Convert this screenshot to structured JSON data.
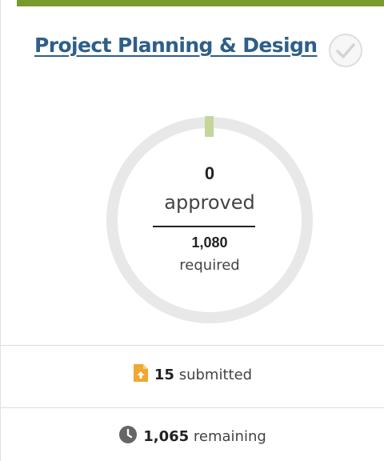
{
  "card": {
    "accent_color": "#7a9a2b",
    "title": "Project Planning & Design",
    "title_color": "#2d5f8a",
    "check_icon": "check-circle-icon"
  },
  "progress": {
    "approved_count": "0",
    "approved_label": "approved",
    "required_count": "1,080",
    "required_label": "required",
    "approved_fraction": 0,
    "ring_track_color": "#e8e8e8",
    "ring_marker_color": "#c5d69a"
  },
  "stats": {
    "submitted": {
      "icon": "file-upload-icon",
      "icon_color": "#f0a830",
      "count": "15",
      "label": "submitted"
    },
    "remaining": {
      "icon": "clock-icon",
      "icon_color": "#666666",
      "count": "1,065",
      "label": "remaining"
    }
  }
}
